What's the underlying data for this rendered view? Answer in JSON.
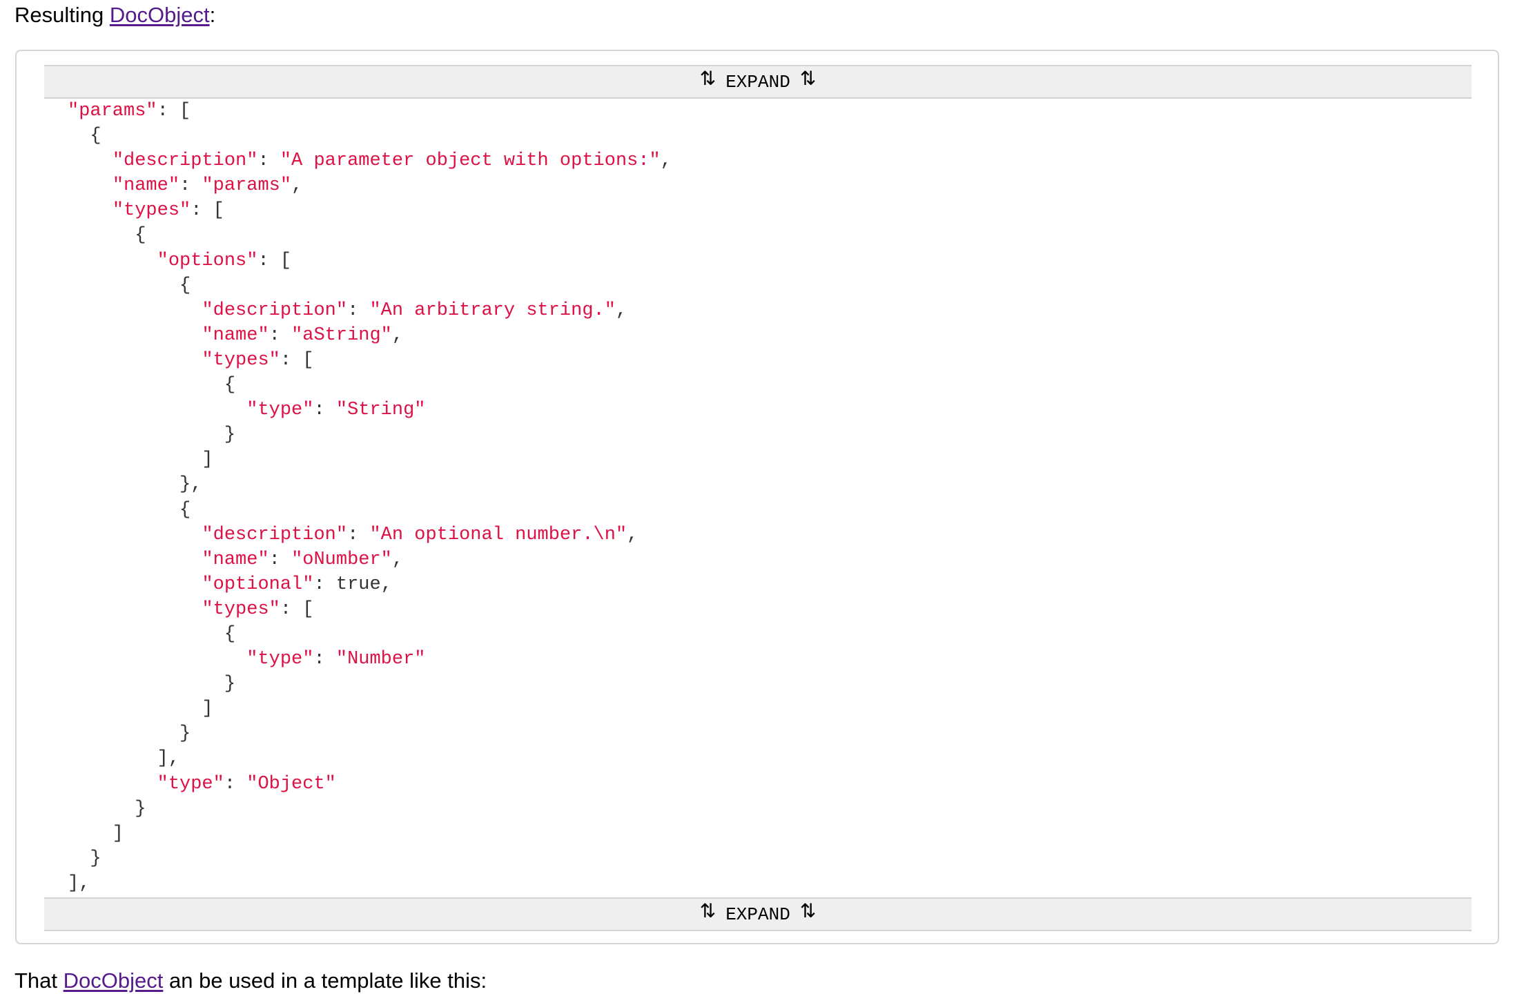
{
  "intro": {
    "prefix": "Resulting ",
    "link": "DocObject",
    "suffix": ":"
  },
  "expand": {
    "label": "EXPAND",
    "icon": "⇅"
  },
  "code_lines": [
    [
      [
        "s",
        "\"params\""
      ],
      [
        "p",
        ": ["
      ]
    ],
    [
      [
        "p",
        "  {"
      ]
    ],
    [
      [
        "p",
        "    "
      ],
      [
        "s",
        "\"description\""
      ],
      [
        "p",
        ": "
      ],
      [
        "s",
        "\"A parameter object with options:\""
      ],
      [
        "p",
        ","
      ]
    ],
    [
      [
        "p",
        "    "
      ],
      [
        "s",
        "\"name\""
      ],
      [
        "p",
        ": "
      ],
      [
        "s",
        "\"params\""
      ],
      [
        "p",
        ","
      ]
    ],
    [
      [
        "p",
        "    "
      ],
      [
        "s",
        "\"types\""
      ],
      [
        "p",
        ": ["
      ]
    ],
    [
      [
        "p",
        "      {"
      ]
    ],
    [
      [
        "p",
        "        "
      ],
      [
        "s",
        "\"options\""
      ],
      [
        "p",
        ": ["
      ]
    ],
    [
      [
        "p",
        "          {"
      ]
    ],
    [
      [
        "p",
        "            "
      ],
      [
        "s",
        "\"description\""
      ],
      [
        "p",
        ": "
      ],
      [
        "s",
        "\"An arbitrary string.\""
      ],
      [
        "p",
        ","
      ]
    ],
    [
      [
        "p",
        "            "
      ],
      [
        "s",
        "\"name\""
      ],
      [
        "p",
        ": "
      ],
      [
        "s",
        "\"aString\""
      ],
      [
        "p",
        ","
      ]
    ],
    [
      [
        "p",
        "            "
      ],
      [
        "s",
        "\"types\""
      ],
      [
        "p",
        ": ["
      ]
    ],
    [
      [
        "p",
        "              {"
      ]
    ],
    [
      [
        "p",
        "                "
      ],
      [
        "s",
        "\"type\""
      ],
      [
        "p",
        ": "
      ],
      [
        "s",
        "\"String\""
      ]
    ],
    [
      [
        "p",
        "              }"
      ]
    ],
    [
      [
        "p",
        "            ]"
      ]
    ],
    [
      [
        "p",
        "          },"
      ]
    ],
    [
      [
        "p",
        "          {"
      ]
    ],
    [
      [
        "p",
        "            "
      ],
      [
        "s",
        "\"description\""
      ],
      [
        "p",
        ": "
      ],
      [
        "s",
        "\"An optional number.\\n\""
      ],
      [
        "p",
        ","
      ]
    ],
    [
      [
        "p",
        "            "
      ],
      [
        "s",
        "\"name\""
      ],
      [
        "p",
        ": "
      ],
      [
        "s",
        "\"oNumber\""
      ],
      [
        "p",
        ","
      ]
    ],
    [
      [
        "p",
        "            "
      ],
      [
        "s",
        "\"optional\""
      ],
      [
        "p",
        ": "
      ],
      [
        "b",
        "true"
      ],
      [
        "p",
        ","
      ]
    ],
    [
      [
        "p",
        "            "
      ],
      [
        "s",
        "\"types\""
      ],
      [
        "p",
        ": ["
      ]
    ],
    [
      [
        "p",
        "              {"
      ]
    ],
    [
      [
        "p",
        "                "
      ],
      [
        "s",
        "\"type\""
      ],
      [
        "p",
        ": "
      ],
      [
        "s",
        "\"Number\""
      ]
    ],
    [
      [
        "p",
        "              }"
      ]
    ],
    [
      [
        "p",
        "            ]"
      ]
    ],
    [
      [
        "p",
        "          }"
      ]
    ],
    [
      [
        "p",
        "        ],"
      ]
    ],
    [
      [
        "p",
        "        "
      ],
      [
        "s",
        "\"type\""
      ],
      [
        "p",
        ": "
      ],
      [
        "s",
        "\"Object\""
      ]
    ],
    [
      [
        "p",
        "      }"
      ]
    ],
    [
      [
        "p",
        "    ]"
      ]
    ],
    [
      [
        "p",
        "  }"
      ]
    ],
    [
      [
        "p",
        "],"
      ]
    ]
  ],
  "outro": {
    "prefix": "That ",
    "link": "DocObject",
    "suffix": " an be used in a template like this:"
  },
  "colors": {
    "string": "#dd1144",
    "punctuation": "#333333",
    "link": "#551a8b",
    "expand_bar": "#efefef"
  }
}
